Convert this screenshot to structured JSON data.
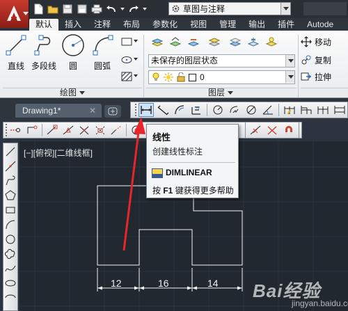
{
  "titlebar": {
    "workspace": "草图与注释"
  },
  "ribbon_tabs": [
    "默认",
    "插入",
    "注释",
    "布局",
    "参数化",
    "视图",
    "管理",
    "输出",
    "插件",
    "Autode"
  ],
  "ribbon": {
    "draw_buttons": [
      "直线",
      "多段线",
      "圆",
      "圆弧"
    ],
    "draw_panel_title": "绘图",
    "layer_state": "未保存的图层状态",
    "current_layer": "0",
    "layer_panel_title": "图层",
    "modify_items": [
      "移动",
      "复制",
      "拉伸"
    ]
  },
  "file_tab": {
    "name": "Drawing1*",
    "close": "✕"
  },
  "viewport": {
    "label": "[−][俯视][二维线框]"
  },
  "tooltip": {
    "title": "线性",
    "description": "创建线性标注",
    "command": "DIMLINEAR",
    "help_prefix": "按 ",
    "help_key": "F1",
    "help_suffix": " 键获得更多帮助"
  },
  "dimensions": [
    "12",
    "16",
    "14"
  ],
  "colors": {
    "canvas": "#212830",
    "annotation_arrow": "#e8262a",
    "app_button": "#c83a2e"
  },
  "watermark": {
    "brand": "Bai经验",
    "url": "jingyan.baidu.com"
  }
}
